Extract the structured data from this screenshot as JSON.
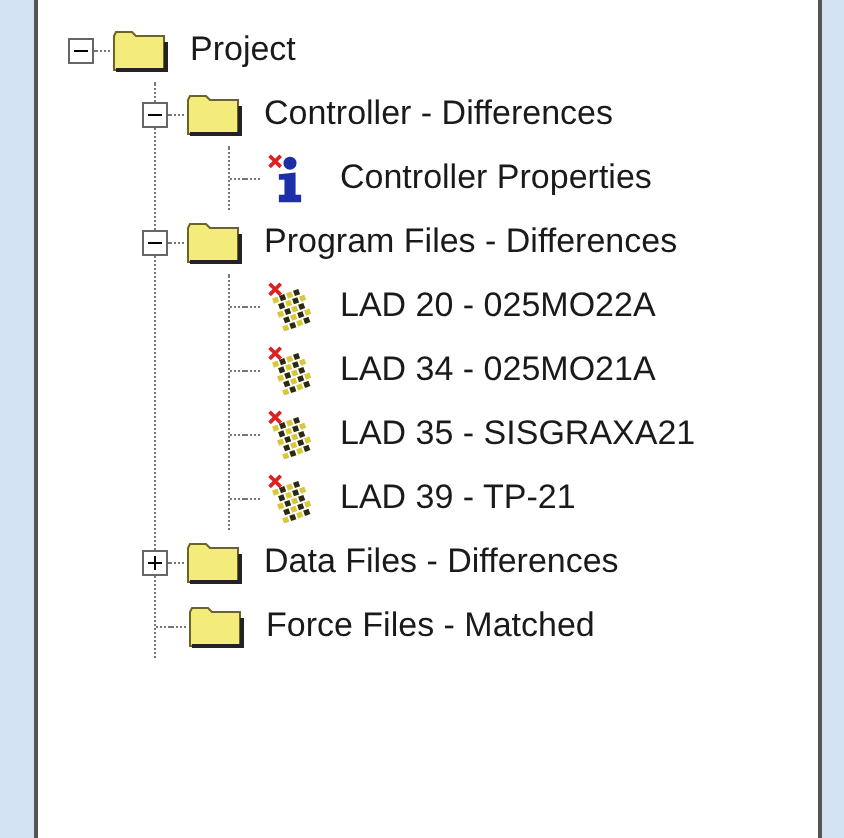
{
  "tree": [
    {
      "label": "Project",
      "kind": "folder",
      "expanded": true,
      "children": [
        {
          "label": "Controller - Differences",
          "kind": "folder",
          "expanded": true,
          "children": [
            {
              "label": "Controller Properties",
              "kind": "info"
            }
          ]
        },
        {
          "label": "Program Files - Differences",
          "kind": "folder",
          "expanded": true,
          "children": [
            {
              "label": "LAD 20 - 025MO22A",
              "kind": "ladder"
            },
            {
              "label": "LAD 34 - 025MO21A",
              "kind": "ladder"
            },
            {
              "label": "LAD 35 - SISGRAXA21",
              "kind": "ladder"
            },
            {
              "label": "LAD 39 - TP-21",
              "kind": "ladder"
            }
          ]
        },
        {
          "label": "Data Files - Differences",
          "kind": "folder",
          "expanded": false
        },
        {
          "label": "Force Files - Matched",
          "kind": "folder"
        }
      ]
    }
  ]
}
